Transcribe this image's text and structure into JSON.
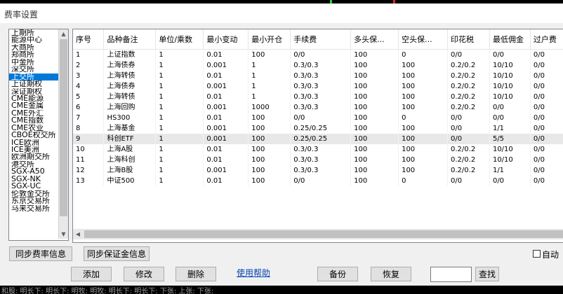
{
  "window": {
    "title": "费率设置"
  },
  "exchanges": [
    "上期所",
    "能源中心",
    "大商所",
    "郑商所",
    "中金所",
    "深交所",
    "上交所",
    "上证期权",
    "深证期权",
    "CME能源",
    "CME金属",
    "CME外汇",
    "CME指数",
    "CME农业",
    "CBOE权交所",
    "ICE欧洲",
    "ICE美洲",
    "欧洲期交所",
    "港交所",
    "SGX-A50",
    "SGX-NK",
    "SGX-UC",
    "伦敦金交所",
    "东京交易所",
    "马来交易所"
  ],
  "selected_exchange_index": 6,
  "table": {
    "columns": [
      "序号",
      "品种备注",
      "单位/乘数",
      "最小变动",
      "最小开仓",
      "手续费",
      "多头保...",
      "空头保...",
      "印花税",
      "最低佣金",
      "过户费"
    ],
    "rows": [
      [
        "1",
        "上证指数",
        "1",
        "0.01",
        "100",
        "0/0",
        "100",
        "0",
        "0/0",
        "0/0",
        "0/0"
      ],
      [
        "2",
        "上海债券",
        "1",
        "0.001",
        "1",
        "0.3/0.3",
        "100",
        "100",
        "0.2/0.2",
        "10/10",
        "0/0"
      ],
      [
        "3",
        "上海转债",
        "1",
        "0.01",
        "1",
        "0.3/0.3",
        "100",
        "100",
        "0.2/0.2",
        "10/10",
        "0/0"
      ],
      [
        "4",
        "上海债券",
        "1",
        "0.001",
        "1",
        "0.3/0.3",
        "100",
        "100",
        "0.2/0.2",
        "10/10",
        "0/0"
      ],
      [
        "5",
        "上海转债",
        "1",
        "0.01",
        "1",
        "0.3/0.3",
        "100",
        "100",
        "0.2/0.2",
        "10/10",
        "0/0"
      ],
      [
        "6",
        "上海回购",
        "1",
        "0.001",
        "1000",
        "0.3/0.3",
        "100",
        "100",
        "0.2/0.2",
        "0/0",
        "0/0"
      ],
      [
        "7",
        "HS300",
        "1",
        "0.01",
        "100",
        "0/0",
        "100",
        "0",
        "0/0",
        "0/0",
        "0/0"
      ],
      [
        "8",
        "上海基金",
        "1",
        "0.001",
        "100",
        "0.25/0.25",
        "100",
        "100",
        "0/0",
        "1/1",
        "0/0"
      ],
      [
        "9",
        "科创ETF",
        "1",
        "0.001",
        "100",
        "0.25/0.25",
        "100",
        "100",
        "0/0",
        "5/5",
        "0/0"
      ],
      [
        "10",
        "上海A股",
        "1",
        "0.01",
        "100",
        "0.3/0.3",
        "100",
        "100",
        "0.2/0.2",
        "10/10",
        "0/0"
      ],
      [
        "11",
        "上海科创",
        "1",
        "0.01",
        "100",
        "0.3/0.3",
        "100",
        "100",
        "0.2/0.2",
        "10/10",
        "0/0"
      ],
      [
        "12",
        "上海B股",
        "1",
        "0.001",
        "100",
        "0.3/0.3",
        "100",
        "100",
        "0.2/0.2",
        "1/1",
        "0/0"
      ],
      [
        "13",
        "中证500",
        "1",
        "0.01",
        "100",
        "0/0",
        "100",
        "0",
        "0/0",
        "0/0",
        "0/0"
      ]
    ],
    "selected_row_index": 8
  },
  "buttons": {
    "sync_fee": "同步费率信息",
    "sync_margin": "同步保证金信息",
    "add": "添加",
    "modify": "修改",
    "delete": "删除",
    "help": "使用帮助",
    "backup": "备份",
    "restore": "恢复",
    "search": "查找"
  },
  "auto_check_label": "自动",
  "bottom_strip_text": "和股: 明长下: 明长下: 明牧: 明牧: 明长下: 明长下: 下张: 上张: 下张:"
}
